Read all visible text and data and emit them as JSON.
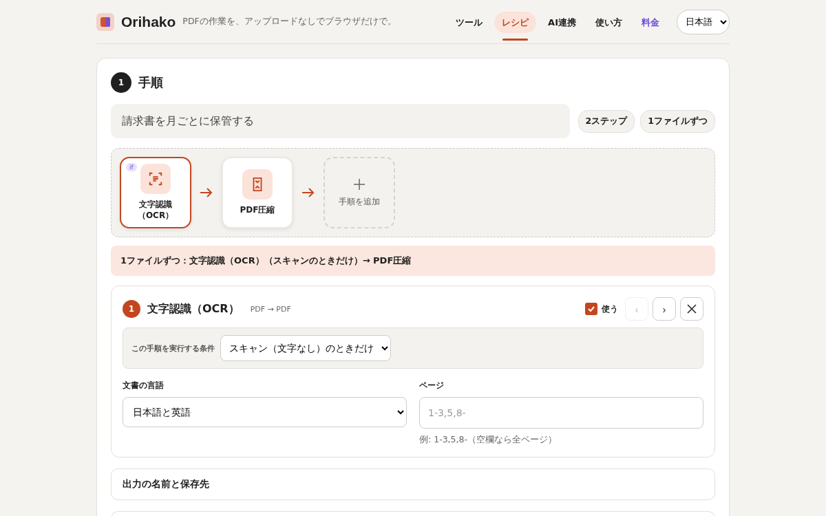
{
  "header": {
    "brand": "Orihako",
    "tagline": "PDFの作業を、アップロードなしでブラウザだけで。",
    "nav": [
      {
        "label": "ツール",
        "selected": false,
        "accent": false
      },
      {
        "label": "レシピ",
        "selected": true,
        "accent": false
      },
      {
        "label": "AI連携",
        "selected": false,
        "accent": false
      },
      {
        "label": "使い方",
        "selected": false,
        "accent": false
      },
      {
        "label": "料金",
        "selected": false,
        "accent": true
      }
    ],
    "language": "日本語"
  },
  "section": {
    "number": "1",
    "title": "手順"
  },
  "recipe": {
    "name": "請求書を月ごとに保管する",
    "tags": [
      "2ステップ",
      "1ファイルずつ"
    ]
  },
  "flow": [
    {
      "kind": "step",
      "label": "文字認識（OCR）",
      "selected": true,
      "badge": "if"
    },
    {
      "kind": "step",
      "label": "PDF圧縮",
      "selected": false
    },
    {
      "kind": "add",
      "label": "手順を追加"
    }
  ],
  "summary": "1ファイルずつ：文字認識（OCR）（スキャンのときだけ）→ PDF圧縮",
  "step": {
    "number": "1",
    "title": "文字認識（OCR）",
    "io": "PDF → PDF",
    "use_label": "使う",
    "use": true,
    "prev": "‹",
    "prev_disabled": true,
    "next": "›",
    "next_disabled": false,
    "condition": {
      "label": "この手順を実行する条件",
      "value": "スキャン（文字なし）のときだけ"
    },
    "language": {
      "label": "文書の言語",
      "value": "日本語と英語"
    },
    "pages": {
      "label": "ページ",
      "placeholder": "1-3,5,8-",
      "hint": "例: 1-3,5,8-（空欄なら全ページ）"
    }
  },
  "sections": [
    {
      "title": "出力の名前と保存先"
    }
  ]
}
